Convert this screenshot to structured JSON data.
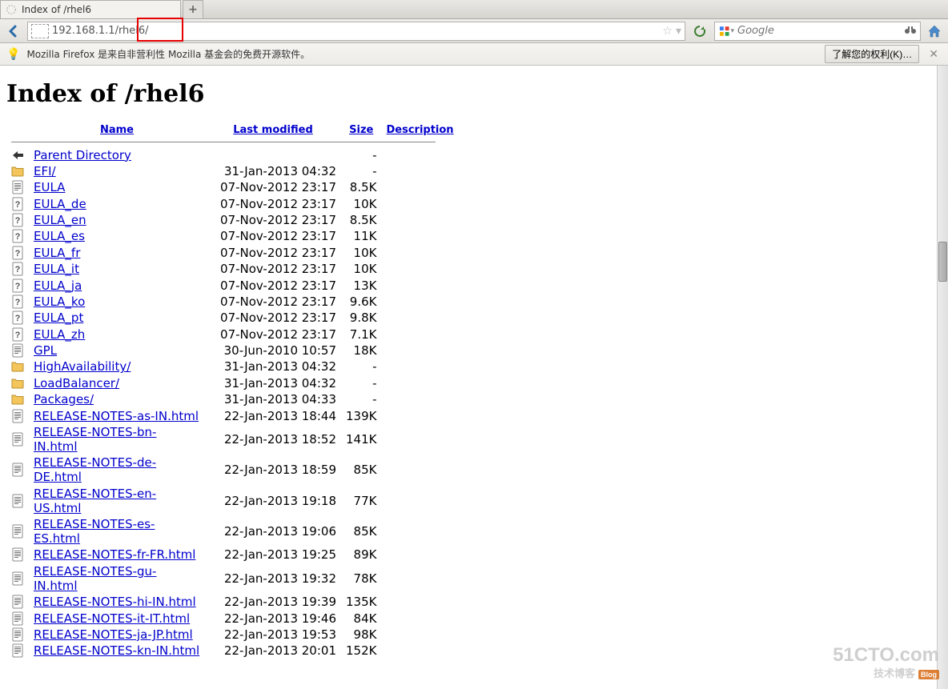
{
  "tab": {
    "title": "Index of /rhel6"
  },
  "url": {
    "value": "192.168.1.1/rhel6/"
  },
  "search": {
    "placeholder": "Google"
  },
  "infobar": {
    "message": "Mozilla Firefox 是来自非营利性 Mozilla 基金会的免费开源软件。",
    "rights_button": "了解您的权利(K)…"
  },
  "page": {
    "heading": "Index of /rhel6",
    "columns": {
      "name": "Name",
      "modified": "Last modified",
      "size": "Size",
      "desc": "Description"
    },
    "rows": [
      {
        "icon": "back",
        "name": "Parent Directory",
        "modified": "",
        "size": "-"
      },
      {
        "icon": "folder",
        "name": "EFI/",
        "modified": "31-Jan-2013 04:32",
        "size": "-"
      },
      {
        "icon": "text",
        "name": "EULA",
        "modified": "07-Nov-2012 23:17",
        "size": "8.5K"
      },
      {
        "icon": "unknown",
        "name": "EULA_de",
        "modified": "07-Nov-2012 23:17",
        "size": "10K"
      },
      {
        "icon": "unknown",
        "name": "EULA_en",
        "modified": "07-Nov-2012 23:17",
        "size": "8.5K"
      },
      {
        "icon": "unknown",
        "name": "EULA_es",
        "modified": "07-Nov-2012 23:17",
        "size": "11K"
      },
      {
        "icon": "unknown",
        "name": "EULA_fr",
        "modified": "07-Nov-2012 23:17",
        "size": "10K"
      },
      {
        "icon": "unknown",
        "name": "EULA_it",
        "modified": "07-Nov-2012 23:17",
        "size": "10K"
      },
      {
        "icon": "unknown",
        "name": "EULA_ja",
        "modified": "07-Nov-2012 23:17",
        "size": "13K"
      },
      {
        "icon": "unknown",
        "name": "EULA_ko",
        "modified": "07-Nov-2012 23:17",
        "size": "9.6K"
      },
      {
        "icon": "unknown",
        "name": "EULA_pt",
        "modified": "07-Nov-2012 23:17",
        "size": "9.8K"
      },
      {
        "icon": "unknown",
        "name": "EULA_zh",
        "modified": "07-Nov-2012 23:17",
        "size": "7.1K"
      },
      {
        "icon": "text",
        "name": "GPL",
        "modified": "30-Jun-2010 10:57",
        "size": "18K"
      },
      {
        "icon": "folder",
        "name": "HighAvailability/",
        "modified": "31-Jan-2013 04:32",
        "size": "-"
      },
      {
        "icon": "folder",
        "name": "LoadBalancer/",
        "modified": "31-Jan-2013 04:32",
        "size": "-"
      },
      {
        "icon": "folder",
        "name": "Packages/",
        "modified": "31-Jan-2013 04:33",
        "size": "-"
      },
      {
        "icon": "text",
        "name": "RELEASE-NOTES-as-IN.html",
        "modified": "22-Jan-2013 18:44",
        "size": "139K"
      },
      {
        "icon": "text",
        "name": "RELEASE-NOTES-bn-IN.html",
        "modified": "22-Jan-2013 18:52",
        "size": "141K"
      },
      {
        "icon": "text",
        "name": "RELEASE-NOTES-de-DE.html",
        "modified": "22-Jan-2013 18:59",
        "size": "85K"
      },
      {
        "icon": "text",
        "name": "RELEASE-NOTES-en-US.html",
        "modified": "22-Jan-2013 19:18",
        "size": "77K"
      },
      {
        "icon": "text",
        "name": "RELEASE-NOTES-es-ES.html",
        "modified": "22-Jan-2013 19:06",
        "size": "85K"
      },
      {
        "icon": "text",
        "name": "RELEASE-NOTES-fr-FR.html",
        "modified": "22-Jan-2013 19:25",
        "size": "89K"
      },
      {
        "icon": "text",
        "name": "RELEASE-NOTES-gu-IN.html",
        "modified": "22-Jan-2013 19:32",
        "size": "78K"
      },
      {
        "icon": "text",
        "name": "RELEASE-NOTES-hi-IN.html",
        "modified": "22-Jan-2013 19:39",
        "size": "135K"
      },
      {
        "icon": "text",
        "name": "RELEASE-NOTES-it-IT.html",
        "modified": "22-Jan-2013 19:46",
        "size": "84K"
      },
      {
        "icon": "text",
        "name": "RELEASE-NOTES-ja-JP.html",
        "modified": "22-Jan-2013 19:53",
        "size": "98K"
      },
      {
        "icon": "text",
        "name": "RELEASE-NOTES-kn-IN.html",
        "modified": "22-Jan-2013 20:01",
        "size": "152K"
      }
    ]
  },
  "watermark": {
    "top": "51CTO.com",
    "bottom": "技术博客",
    "badge": "Blog"
  }
}
